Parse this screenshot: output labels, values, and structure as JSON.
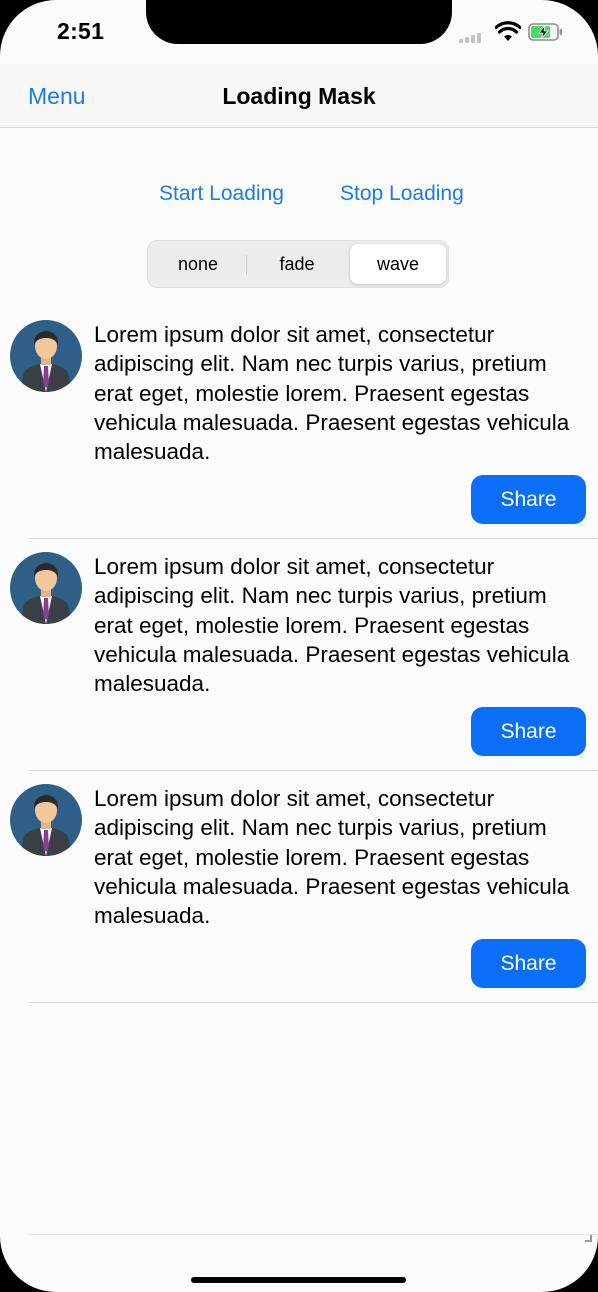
{
  "status_bar": {
    "time": "2:51",
    "icons": [
      "cellular-signal-icon",
      "wifi-icon",
      "battery-charging-icon"
    ]
  },
  "nav": {
    "menu_label": "Menu",
    "title": "Loading Mask"
  },
  "actions": {
    "start_label": "Start Loading",
    "stop_label": "Stop Loading"
  },
  "segmented": {
    "options": [
      "none",
      "fade",
      "wave"
    ],
    "selected": "wave"
  },
  "feed": {
    "items": [
      {
        "avatar_icon": "user-avatar-icon",
        "text": "Lorem ipsum dolor sit amet, consectetur adipiscing elit. Nam nec turpis varius, pretium erat eget, molestie lorem. Praesent egestas vehicula malesuada. Praesent egestas vehicula malesuada.",
        "share_label": "Share"
      },
      {
        "avatar_icon": "user-avatar-icon",
        "text": "Lorem ipsum dolor sit amet, consectetur adipiscing elit. Nam nec turpis varius, pretium erat eget, molestie lorem. Praesent egestas vehicula malesuada. Praesent egestas vehicula malesuada.",
        "share_label": "Share"
      },
      {
        "avatar_icon": "user-avatar-icon",
        "text": "Lorem ipsum dolor sit amet, consectetur adipiscing elit. Nam nec turpis varius, pretium erat eget, molestie lorem. Praesent egestas vehicula malesuada. Praesent egestas vehicula malesuada.",
        "share_label": "Share"
      }
    ]
  },
  "colors": {
    "accent": "#1b7ddf",
    "share_button": "#0a6ef7",
    "background": "#fbfbfb"
  }
}
